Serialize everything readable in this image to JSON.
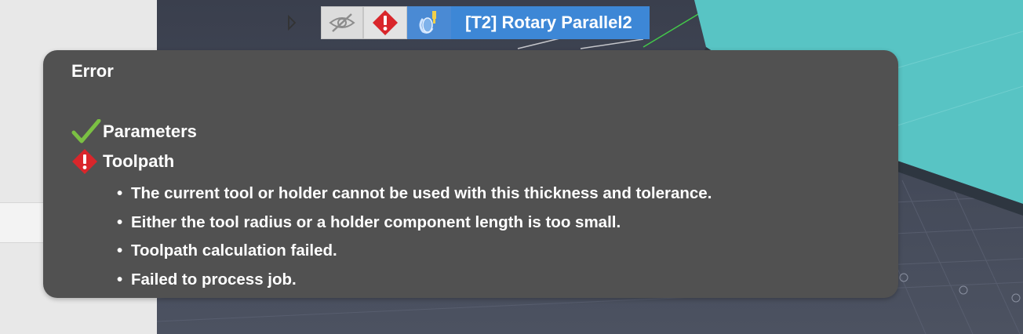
{
  "browser_row": {
    "label": "[T2] Rotary Parallel2",
    "icons": [
      "expand-arrow-icon",
      "eye-hidden-icon",
      "error-diamond-icon",
      "rotary-operation-icon"
    ]
  },
  "tooltip": {
    "title": "Error",
    "sections": [
      {
        "status": "ok",
        "icon": "checkmark-icon",
        "label": "Parameters"
      },
      {
        "status": "error",
        "icon": "error-diamond-icon",
        "label": "Toolpath"
      }
    ],
    "messages": [
      "The current tool or holder cannot be used with this thickness and tolerance.",
      "Either the tool radius or a holder component length is too small.",
      "Toolpath calculation failed.",
      "Failed to process job."
    ],
    "bullet": "•"
  },
  "colors": {
    "tooltip_bg": "#515151",
    "selection_blue": "#3d87d6",
    "error_red": "#d9262b",
    "check_green": "#7bc043",
    "stock_teal": "#58c4c4"
  }
}
